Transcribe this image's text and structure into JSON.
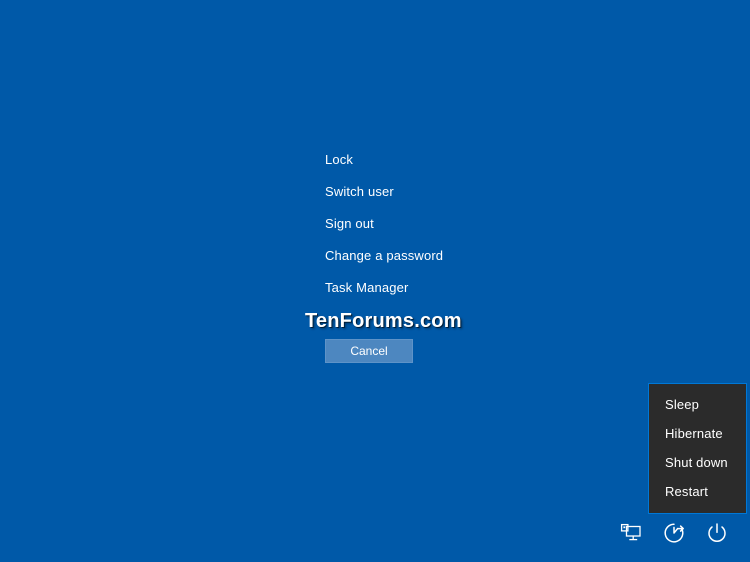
{
  "screen": {
    "name": "windows-security-options",
    "background_color": "#0059a8"
  },
  "security_options": {
    "items": [
      {
        "label": "Lock",
        "name": "lock"
      },
      {
        "label": "Switch user",
        "name": "switch-user"
      },
      {
        "label": "Sign out",
        "name": "sign-out"
      },
      {
        "label": "Change a password",
        "name": "change-a-password"
      },
      {
        "label": "Task Manager",
        "name": "task-manager"
      }
    ]
  },
  "watermark": {
    "text": "TenForums.com"
  },
  "cancel": {
    "label": "Cancel",
    "fill_color": "#4d87c0",
    "border_color": "#5e93c8"
  },
  "bottom_icons": {
    "items": [
      {
        "name": "network-icon",
        "title": "Network"
      },
      {
        "name": "ease-of-access-icon",
        "title": "Ease of Access"
      },
      {
        "name": "power-icon",
        "title": "Power"
      }
    ]
  },
  "power_menu": {
    "accent_color": "#0078d7",
    "background_color": "#2b2b2b",
    "items": [
      {
        "label": "Sleep",
        "name": "sleep"
      },
      {
        "label": "Hibernate",
        "name": "hibernate"
      },
      {
        "label": "Shut down",
        "name": "shut-down"
      },
      {
        "label": "Restart",
        "name": "restart"
      }
    ]
  }
}
